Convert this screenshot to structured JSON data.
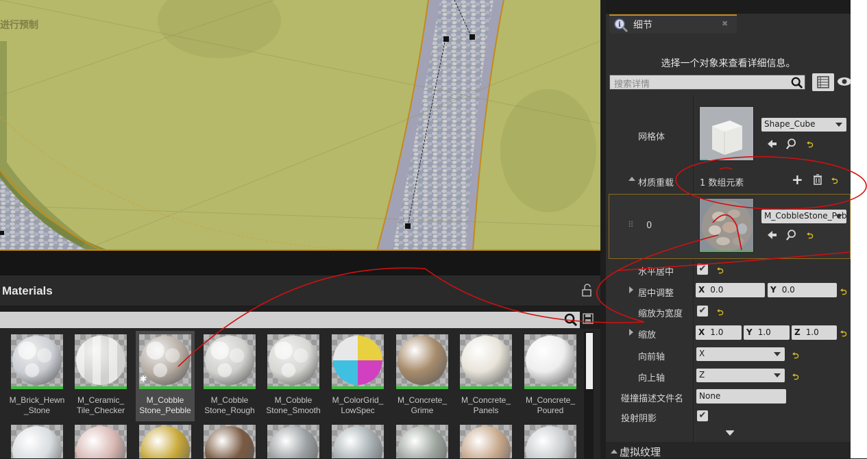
{
  "viewport": {
    "overlay_text": "进行预制"
  },
  "content_browser": {
    "title": "Materials",
    "row1": [
      {
        "label": "M_Brick_Hewn_Stone",
        "line1": "M_Brick_Hewn",
        "line2": "_Stone",
        "color": "#c9cdd2",
        "pattern": "stone"
      },
      {
        "label": "M_Ceramic_Tile_Checker",
        "line1": "M_Ceramic_",
        "line2": "Tile_Checker",
        "color": "#e3e3e0",
        "pattern": "tile"
      },
      {
        "label": "M_CobbleStone_Pebble",
        "line1": "M_Cobble",
        "line2": "Stone_Pebble",
        "color": "#b5aca2",
        "pattern": "pebble",
        "selected": true
      },
      {
        "label": "M_CobbleStone_Rough",
        "line1": "M_Cobble",
        "line2": "Stone_Rough",
        "color": "#cfcfcc",
        "pattern": "stone"
      },
      {
        "label": "M_CobbleStone_Smooth",
        "line1": "M_Cobble",
        "line2": "Stone_Smooth",
        "color": "#d6d6d2",
        "pattern": "stone"
      },
      {
        "label": "M_ColorGrid_LowSpec",
        "line1": "M_ColorGrid_",
        "line2": "LowSpec",
        "color": "#e0d050",
        "pattern": "grid"
      },
      {
        "label": "M_Concrete_Grime",
        "line1": "M_Concrete_",
        "line2": "Grime",
        "color": "#a88c6c",
        "pattern": "plain"
      },
      {
        "label": "M_Concrete_Panels",
        "line1": "M_Concrete_",
        "line2": "Panels",
        "color": "#e8e4da",
        "pattern": "plain"
      },
      {
        "label": "M_Concrete_Poured",
        "line1": "M_Concrete_",
        "line2": "Poured",
        "color": "#eeeeee",
        "pattern": "plain"
      }
    ],
    "row2_colors": [
      "#d8dde0",
      "#d9b8b4",
      "#c8a838",
      "#7a5a42",
      "#9aa0a2",
      "#a8b0b4",
      "#9ea6a0",
      "#c8a88c",
      "#c8ccce"
    ]
  },
  "details": {
    "tab_title": "细节",
    "hint": "选择一个对象来查看详细信息。",
    "search_placeholder": "搜索详情",
    "mesh_label": "网格体",
    "mesh_value": "Shape_Cube",
    "material_override_label": "材质重载",
    "array_elements": "1 数组元素",
    "index_label": "0",
    "material_value": "M_CobbleStone_Pebble",
    "rows": {
      "h_center": "水平居中",
      "center_adjust": "居中调整",
      "center_x": "0.0",
      "center_y": "0.0",
      "scale_to_width": "缩放为宽度",
      "scale": "缩放",
      "scale_x": "1.0",
      "scale_y": "1.0",
      "scale_z": "1.0",
      "forward_axis": "向前轴",
      "forward_value": "X",
      "up_axis": "向上轴",
      "up_value": "Z",
      "collision_profile": "碰撞描述文件名",
      "collision_value": "None",
      "cast_shadow": "投射阴影"
    },
    "virtual_texture": "虚拟纹理"
  },
  "colors": {
    "accent": "#c48a1a",
    "annotation": "#d01010",
    "reset": "#e0c020",
    "thumb_bar": "#3bbf3b"
  }
}
